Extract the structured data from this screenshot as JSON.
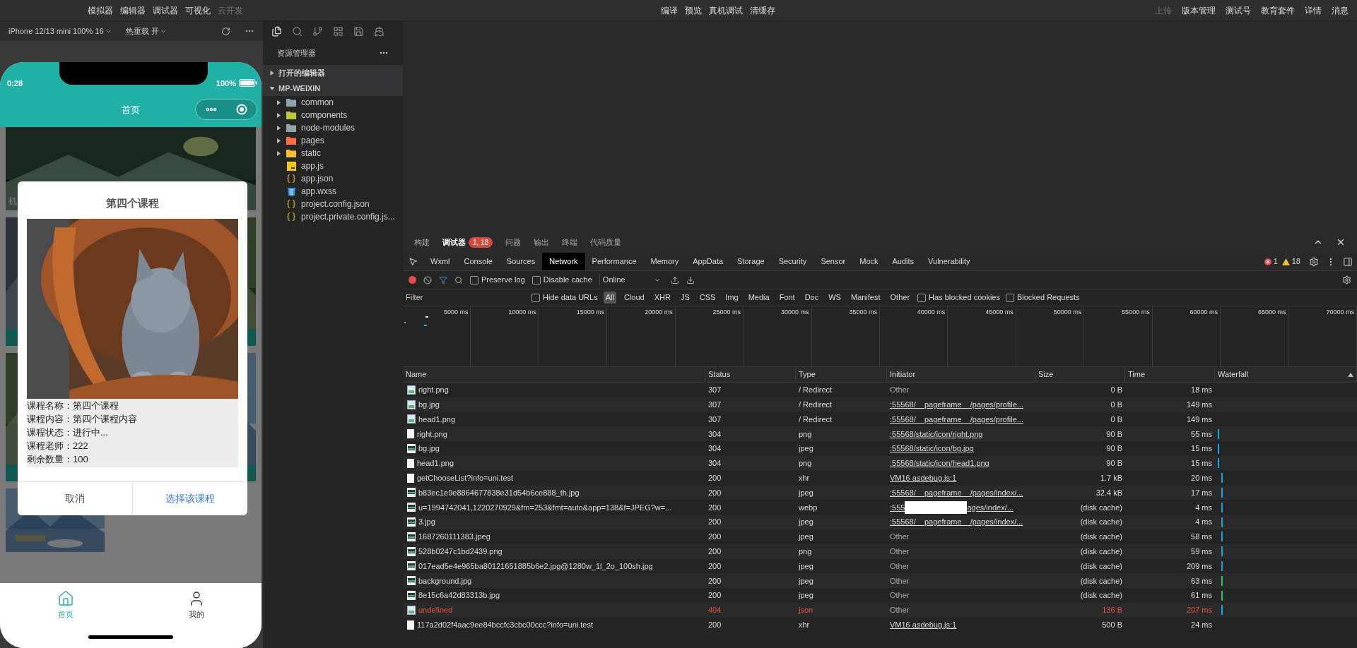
{
  "menu_bar": {
    "left": [
      {
        "label": "模拟器",
        "disabled": false
      },
      {
        "label": "编辑器",
        "disabled": false
      },
      {
        "label": "调试器",
        "disabled": false
      },
      {
        "label": "可视化",
        "disabled": false
      },
      {
        "label": "云开发",
        "disabled": true
      }
    ],
    "center": [
      {
        "label": "编译",
        "disabled": false
      },
      {
        "label": "预览",
        "disabled": false
      },
      {
        "label": "真机调试",
        "disabled": false
      },
      {
        "label": "清缓存",
        "disabled": false
      }
    ],
    "right": [
      {
        "label": "上传",
        "disabled": true
      },
      {
        "label": "版本管理",
        "disabled": false
      },
      {
        "label": "测试号",
        "disabled": false
      },
      {
        "label": "教育套件",
        "disabled": false
      },
      {
        "label": "详情",
        "disabled": false
      },
      {
        "label": "消息",
        "disabled": false
      }
    ]
  },
  "simulator": {
    "device": "iPhone 12/13 mini 100% 16",
    "hot_reload": "热重载 开",
    "phone": {
      "time": "0:28",
      "battery": "100%",
      "title": "首页",
      "banner_caption": "机",
      "modal": {
        "title": "第四个课程",
        "lines": [
          "课程名称：第四个课程",
          "课程内容：第四个课程内容",
          "课程状态：进行中...",
          "课程老师：222",
          "剩余数量：100"
        ],
        "cancel": "取消",
        "confirm": "选择该课程"
      },
      "tabs": [
        {
          "label": "首页",
          "kind": "home",
          "selected": true
        },
        {
          "label": "我的",
          "kind": "user",
          "selected": false
        }
      ]
    }
  },
  "explorer": {
    "title": "资源管理器",
    "sections": [
      {
        "label": "打开的编辑器",
        "expanded": false
      },
      {
        "label": "MP-WEIXIN",
        "expanded": true,
        "children": [
          {
            "label": "common",
            "kind": "folder",
            "color": "#90a4ae",
            "expanded": false
          },
          {
            "label": "components",
            "kind": "folder",
            "color": "#c0ca33",
            "expanded": false
          },
          {
            "label": "node-modules",
            "kind": "folder",
            "color": "#90a4ae",
            "expanded": false
          },
          {
            "label": "pages",
            "kind": "folder",
            "color": "#ff7043",
            "expanded": false
          },
          {
            "label": "static",
            "kind": "folder",
            "color": "#fbc02d",
            "expanded": false
          },
          {
            "label": "app.js",
            "kind": "js"
          },
          {
            "label": "app.json",
            "kind": "json"
          },
          {
            "label": "app.wxss",
            "kind": "wxss"
          },
          {
            "label": "project.config.json",
            "kind": "json"
          },
          {
            "label": "project.private.config.js...",
            "kind": "json"
          }
        ]
      }
    ]
  },
  "devtools": {
    "drawer_tabs": [
      {
        "label": "构建",
        "selected": false
      },
      {
        "label": "调试器",
        "selected": true,
        "badge": "1, 18"
      },
      {
        "label": "问题",
        "selected": false
      },
      {
        "label": "输出",
        "selected": false
      },
      {
        "label": "终端",
        "selected": false
      },
      {
        "label": "代码质量",
        "selected": false
      }
    ],
    "panel_tabs": [
      {
        "label": "Wxml",
        "selected": false
      },
      {
        "label": "Console",
        "selected": false
      },
      {
        "label": "Sources",
        "selected": false
      },
      {
        "label": "Network",
        "selected": true
      },
      {
        "label": "Performance",
        "selected": false
      },
      {
        "label": "Memory",
        "selected": false
      },
      {
        "label": "AppData",
        "selected": false
      },
      {
        "label": "Storage",
        "selected": false
      },
      {
        "label": "Security",
        "selected": false
      },
      {
        "label": "Sensor",
        "selected": false
      },
      {
        "label": "Mock",
        "selected": false
      },
      {
        "label": "Audits",
        "selected": false
      },
      {
        "label": "Vulnerability",
        "selected": false
      }
    ],
    "errors": "1",
    "warnings": "18",
    "toolbar": {
      "recording": true,
      "preserve_log": {
        "label": "Preserve log",
        "checked": false
      },
      "disable_cache": {
        "label": "Disable cache",
        "checked": false
      },
      "throttle": "Online"
    },
    "filter": {
      "placeholder": "Filter",
      "hide_data_urls": {
        "label": "Hide data URLs",
        "checked": false
      },
      "types": [
        {
          "label": "All",
          "selected": true
        },
        {
          "label": "Cloud",
          "selected": false
        },
        {
          "label": "XHR",
          "selected": false
        },
        {
          "label": "JS",
          "selected": false
        },
        {
          "label": "CSS",
          "selected": false
        },
        {
          "label": "Img",
          "selected": false
        },
        {
          "label": "Media",
          "selected": false
        },
        {
          "label": "Font",
          "selected": false
        },
        {
          "label": "Doc",
          "selected": false
        },
        {
          "label": "WS",
          "selected": false
        },
        {
          "label": "Manifest",
          "selected": false
        },
        {
          "label": "Other",
          "selected": false
        }
      ],
      "blocked_cookies": {
        "label": "Has blocked cookies",
        "checked": false
      },
      "blocked_requests": {
        "label": "Blocked Requests",
        "checked": false
      }
    },
    "timeline_ticks": [
      "5000 ms",
      "10000 ms",
      "15000 ms",
      "20000 ms",
      "25000 ms",
      "30000 ms",
      "35000 ms",
      "40000 ms",
      "45000 ms",
      "50000 ms",
      "55000 ms",
      "60000 ms",
      "65000 ms",
      "70000 ms"
    ],
    "table": {
      "columns": [
        "Name",
        "Status",
        "Type",
        "Initiator",
        "Size",
        "Time",
        "Waterfall"
      ],
      "rows": [
        {
          "name": "right.png",
          "status": "307",
          "type": "/ Redirect",
          "initiator": "Other",
          "link": false,
          "size": "0 B",
          "time": "18 ms",
          "error": false,
          "kind": "redirect"
        },
        {
          "name": "bg.jpg",
          "status": "307",
          "type": "/ Redirect",
          "initiator": ":55568/__pageframe__/pages/profile...",
          "link": true,
          "size": "0 B",
          "time": "149 ms",
          "error": false,
          "kind": "redirect"
        },
        {
          "name": "head1.png",
          "status": "307",
          "type": "/ Redirect",
          "initiator": ":55568/__pageframe__/pages/profile...",
          "link": true,
          "size": "0 B",
          "time": "149 ms",
          "error": false,
          "kind": "redirect"
        },
        {
          "name": "right.png",
          "status": "304",
          "type": "png",
          "initiator": ":55568/static/icon/right.png",
          "link": true,
          "size": "90 B",
          "time": "55 ms",
          "error": false,
          "kind": "file",
          "color": "#0ea5e9"
        },
        {
          "name": "bg.jpg",
          "status": "304",
          "type": "jpeg",
          "initiator": ":55568/static/icon/bg.jpg",
          "link": true,
          "size": "90 B",
          "time": "15 ms",
          "error": false,
          "kind": "thumb",
          "color": "#0ea5e9"
        },
        {
          "name": "head1.png",
          "status": "304",
          "type": "png",
          "initiator": ":55568/static/icon/head1.png",
          "link": true,
          "size": "90 B",
          "time": "15 ms",
          "error": false,
          "kind": "file",
          "color": "#0ea5e9"
        },
        {
          "name": "getChooseList?info=uni.test",
          "status": "200",
          "type": "xhr",
          "initiator": "VM16 asdebug.js:1",
          "link": true,
          "size": "1.7 kB",
          "time": "20 ms",
          "error": false,
          "kind": "file",
          "color": "#0ea5e9"
        },
        {
          "name": "b83ec1e9e8864677838e31d54b6ce888_th.jpg",
          "status": "200",
          "type": "jpeg",
          "initiator": ":55568/__pageframe__/pages/index/...",
          "link": true,
          "size": "32.4 kB",
          "time": "17 ms",
          "error": false,
          "kind": "thumb",
          "color": "#0ea5e9"
        },
        {
          "name": "u=1994742041,1220270929&fm=253&fmt=auto&app=138&f=JPEG?w=...",
          "status": "200",
          "type": "webp",
          "initiator": ":555",
          "initiator_tail": "ages/index/...",
          "link": true,
          "size": "(disk cache)",
          "time": "4 ms",
          "error": false,
          "kind": "thumb",
          "color": "#0ea5e9"
        },
        {
          "name": "3.jpg",
          "status": "200",
          "type": "jpeg",
          "initiator": ":55568/__pageframe__/pages/index/...",
          "link": true,
          "size": "(disk cache)",
          "time": "4 ms",
          "error": false,
          "kind": "thumb",
          "color": "#0ea5e9"
        },
        {
          "name": "1687260111383.jpeg",
          "status": "200",
          "type": "jpeg",
          "initiator": "Other",
          "link": false,
          "size": "(disk cache)",
          "time": "58 ms",
          "error": false,
          "kind": "thumb",
          "color": "#0ea5e9"
        },
        {
          "name": "528b0247c1bd2439.png",
          "status": "200",
          "type": "png",
          "initiator": "Other",
          "link": false,
          "size": "(disk cache)",
          "time": "59 ms",
          "error": false,
          "kind": "thumb",
          "color": "#0ea5e9"
        },
        {
          "name": "017ead5e4e965ba80121651885b6e2.jpg@1280w_1l_2o_100sh.jpg",
          "status": "200",
          "type": "jpeg",
          "initiator": "Other",
          "link": false,
          "size": "(disk cache)",
          "time": "209 ms",
          "error": false,
          "kind": "thumb",
          "color": "#0ea5e9"
        },
        {
          "name": "background.jpg",
          "status": "200",
          "type": "jpeg",
          "initiator": "Other",
          "link": false,
          "size": "(disk cache)",
          "time": "63 ms",
          "error": false,
          "kind": "thumb",
          "color": "#22c55e"
        },
        {
          "name": "8e15c6a42d83313b.jpg",
          "status": "200",
          "type": "jpeg",
          "initiator": "Other",
          "link": false,
          "size": "(disk cache)",
          "time": "61 ms",
          "error": false,
          "kind": "thumb",
          "color": "#22c55e"
        },
        {
          "name": "undefined",
          "status": "404",
          "type": "json",
          "initiator": "Other",
          "link": false,
          "size": "136 B",
          "time": "207 ms",
          "error": true,
          "kind": "redirect",
          "color": "#0ea5e9"
        },
        {
          "name": "117a2d02f4aac9ee84bccfc3cbc00ccc?info=uni.test",
          "status": "200",
          "type": "xhr",
          "initiator": "VM16 asdebug.js:1",
          "link": true,
          "size": "500 B",
          "time": "24 ms",
          "error": false,
          "kind": "file"
        }
      ]
    }
  }
}
